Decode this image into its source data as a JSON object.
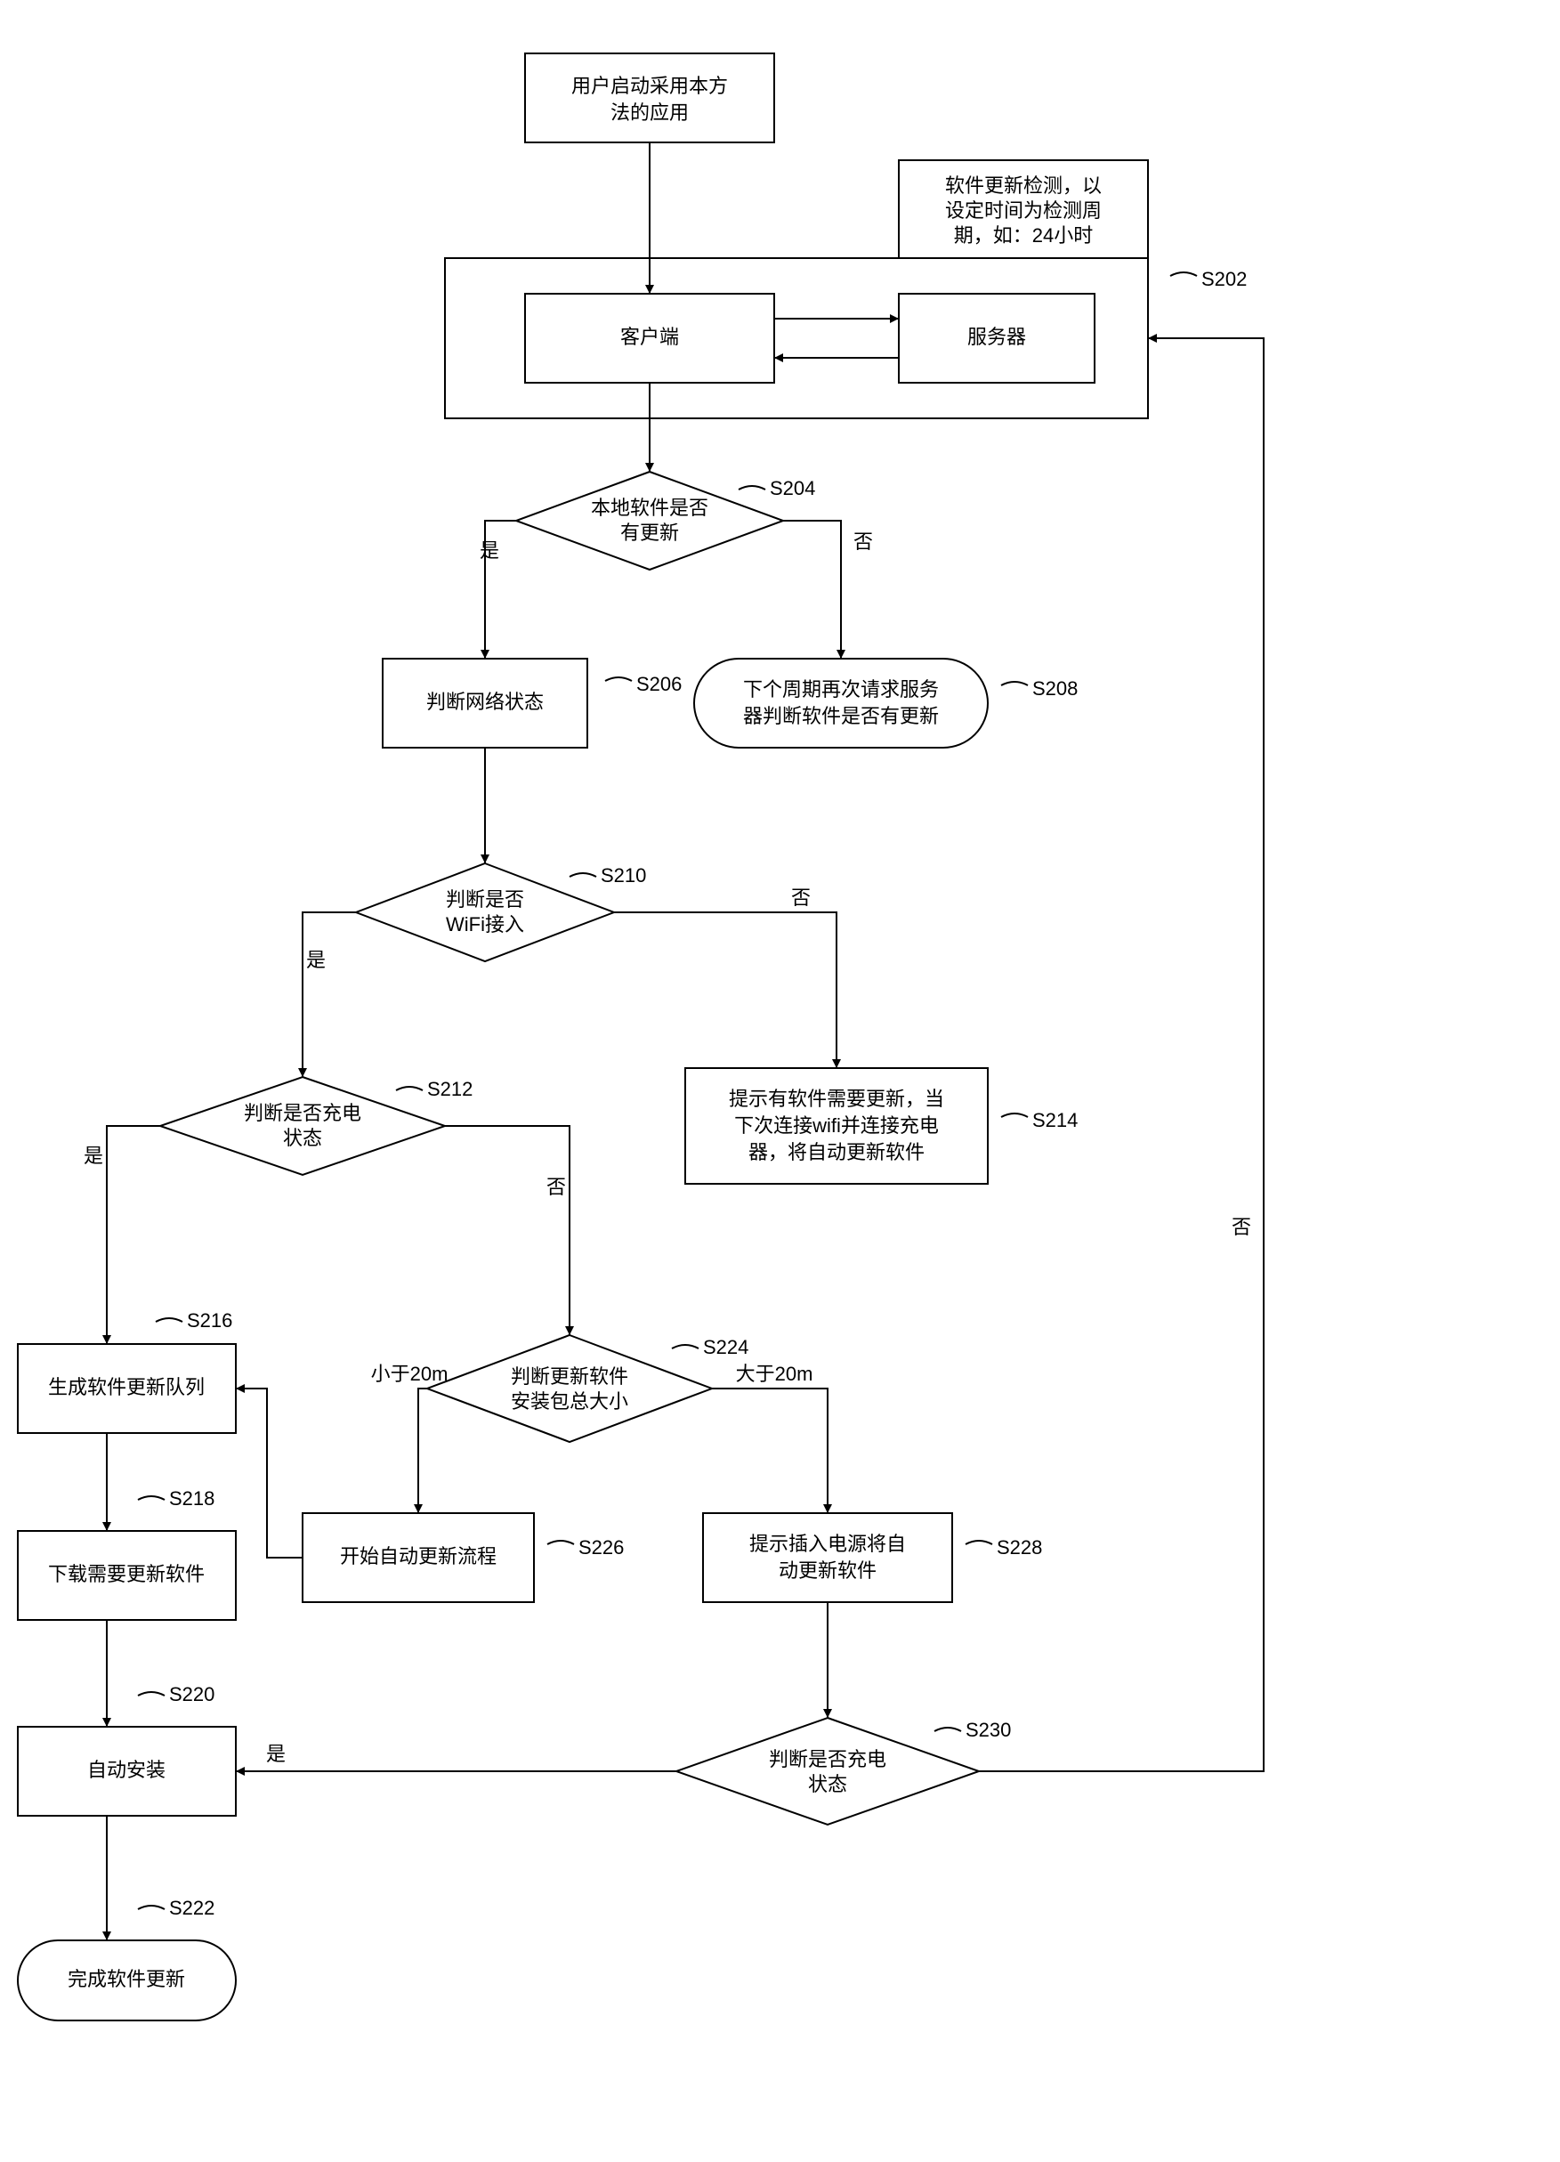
{
  "nodes": {
    "start": {
      "l1": "用户启动采用本方",
      "l2": "法的应用"
    },
    "note": {
      "l1": "软件更新检测，以",
      "l2": "设定时间为检测周",
      "l3": "期，如：24小时"
    },
    "client": {
      "l1": "客户端"
    },
    "server": {
      "l1": "服务器"
    },
    "d204": {
      "l1": "本地软件是否",
      "l2": "有更新"
    },
    "s206": {
      "l1": "判断网络状态"
    },
    "t208": {
      "l1": "下个周期再次请求服务",
      "l2": "器判断软件是否有更新"
    },
    "d210": {
      "l1": "判断是否",
      "l2": "WiFi接入"
    },
    "d212": {
      "l1": "判断是否充电",
      "l2": "状态"
    },
    "s214": {
      "l1": "提示有软件需要更新，当",
      "l2": "下次连接wifi并连接充电",
      "l3": "器，将自动更新软件"
    },
    "s216": {
      "l1": "生成软件更新队列"
    },
    "s218": {
      "l1": "下载需要更新软件"
    },
    "s220": {
      "l1": "自动安装"
    },
    "t222": {
      "l1": "完成软件更新"
    },
    "d224": {
      "l1": "判断更新软件",
      "l2": "安装包总大小"
    },
    "s226": {
      "l1": "开始自动更新流程"
    },
    "s228": {
      "l1": "提示插入电源将自",
      "l2": "动更新软件"
    },
    "d230": {
      "l1": "判断是否充电",
      "l2": "状态"
    }
  },
  "labels": {
    "s202": "S202",
    "s204": "S204",
    "s206": "S206",
    "s208": "S208",
    "s210": "S210",
    "s212": "S212",
    "s214": "S214",
    "s216": "S216",
    "s218": "S218",
    "s220": "S220",
    "s222": "S222",
    "s224": "S224",
    "s226": "S226",
    "s228": "S228",
    "s230": "S230"
  },
  "edges": {
    "yes": "是",
    "no": "否",
    "lt20m": "小于20m",
    "gt20m": "大于20m"
  }
}
